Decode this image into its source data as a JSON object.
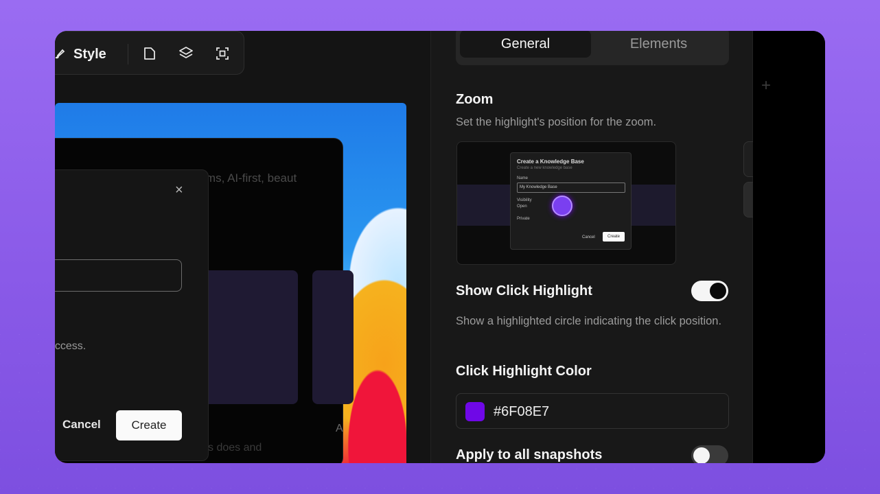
{
  "toolbar": {
    "style_label": "Style",
    "icons": [
      "brush-icon",
      "document-icon",
      "layers-icon",
      "focus-icon"
    ]
  },
  "canvas": {
    "ghost_heading": "eems, AI-first, beaut",
    "dialog": {
      "close_glyph": "×",
      "access_text": "access.",
      "cancel_label": "Cancel",
      "create_label": "Create"
    },
    "ghost_footer": "s does and",
    "ghost_letter": "A"
  },
  "panel": {
    "tabs": [
      {
        "label": "General",
        "active": true
      },
      {
        "label": "Elements",
        "active": false
      }
    ],
    "zoom": {
      "title": "Zoom",
      "description": "Set the highlight's position for the zoom.",
      "preview": {
        "dialog_title": "Create a Knowledge Base",
        "dialog_subtitle": "Create a new knowledge base",
        "name_label": "Name",
        "name_value": "My Knowledge Base",
        "visibility_label": "Visibility",
        "option_open": "Open",
        "option_private": "Private",
        "cancel": "Cancel",
        "create": "Create"
      }
    },
    "click_highlight": {
      "title": "Show Click Highlight",
      "enabled": true,
      "description": "Show a highlighted circle indicating the click position."
    },
    "highlight_color": {
      "title": "Click Highlight Color",
      "value": "#6F08E7"
    },
    "apply_all": {
      "title": "Apply to all snapshots",
      "enabled": false
    }
  },
  "colors": {
    "accent": "#6F08E7",
    "background_purple": "#8a5ae8"
  }
}
